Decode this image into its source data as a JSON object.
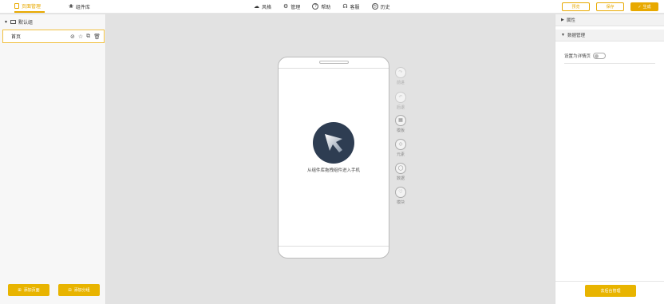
{
  "topbar": {
    "tabs": [
      {
        "label": "页面管理",
        "icon": "page-icon"
      },
      {
        "label": "组件库",
        "icon": "components-icon"
      }
    ],
    "menu": [
      {
        "label": "风格",
        "icon": "style-icon"
      },
      {
        "label": "管理",
        "icon": "gear-icon"
      },
      {
        "label": "帮助",
        "icon": "help-icon"
      },
      {
        "label": "客服",
        "icon": "headset-icon"
      },
      {
        "label": "历史",
        "icon": "history-icon"
      }
    ],
    "preview_label": "预览",
    "save_label": "保存",
    "generate_label": "生成",
    "accent_color": "#e8a900"
  },
  "left": {
    "group_label": "默认组",
    "page_label": "首页",
    "add_page_label": "添加页面",
    "add_group_label": "添加分组"
  },
  "canvas": {
    "drop_hint": "从组件库拖拽组件进入手机",
    "tools": [
      {
        "label": "前进",
        "glyph": "↷",
        "enabled": false
      },
      {
        "label": "后退",
        "glyph": "↶",
        "enabled": false
      },
      {
        "label": "模板",
        "glyph": "▦",
        "enabled": true
      },
      {
        "label": "元素",
        "glyph": "◇",
        "enabled": true
      },
      {
        "label": "数据",
        "glyph": "◯",
        "enabled": true
      },
      {
        "label": "模块",
        "glyph": "♡",
        "enabled": true
      }
    ]
  },
  "right": {
    "section_props": "属性",
    "section_data": "数据管理",
    "field_label": "设置为详情页",
    "footer_button": "去后台管理"
  }
}
